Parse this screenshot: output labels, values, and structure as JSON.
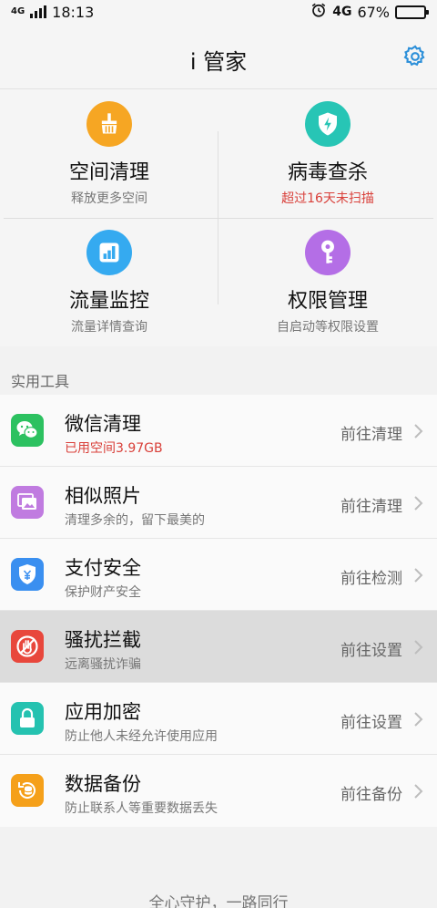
{
  "status_bar": {
    "network_left": "4G",
    "time": "18:13",
    "network_right": "4G",
    "battery_percent_text": "67%",
    "battery_level": 0.67,
    "icons": [
      "signal-icon",
      "alarm-icon",
      "battery-icon"
    ]
  },
  "header": {
    "title": "i 管家",
    "settings_icon": "gear-icon",
    "accent": "#2b8fd9"
  },
  "features": [
    {
      "name": "空间清理",
      "sub": "释放更多空间",
      "icon": "broom-icon",
      "color": "#f6a623"
    },
    {
      "name": "病毒查杀",
      "sub": "超过16天未扫描",
      "icon": "shield-lightning-icon",
      "color": "#27c5b5",
      "sub_color": "#d9403a"
    },
    {
      "name": "流量监控",
      "sub": "流量详情查询",
      "icon": "bar-chart-icon",
      "color": "#35aaf0"
    },
    {
      "name": "权限管理",
      "sub": "自启动等权限设置",
      "icon": "key-icon",
      "color": "#b46ee6"
    }
  ],
  "tools": {
    "section_label": "实用工具",
    "items": [
      {
        "name": "微信清理",
        "sub": "已用空间3.97GB",
        "action": "前往清理",
        "icon": "wechat-icon",
        "color": "#2cc160",
        "sub_color": "#d9403a"
      },
      {
        "name": "相似照片",
        "sub": "清理多余的，留下最美的",
        "action": "前往清理",
        "icon": "photos-icon",
        "color": "#c07be0"
      },
      {
        "name": "支付安全",
        "sub": "保护财产安全",
        "action": "前往检测",
        "icon": "payment-shield-icon",
        "color": "#3a8ff0"
      },
      {
        "name": "骚扰拦截",
        "sub": "远离骚扰诈骗",
        "action": "前往设置",
        "icon": "block-hand-icon",
        "color": "#e8473c",
        "pressed": true
      },
      {
        "name": "应用加密",
        "sub": "防止他人未经允许使用应用",
        "action": "前往设置",
        "icon": "lock-icon",
        "color": "#25c2b0"
      },
      {
        "name": "数据备份",
        "sub": "防止联系人等重要数据丢失",
        "action": "前往备份",
        "icon": "backup-icon",
        "color": "#f5a01a"
      }
    ]
  },
  "footer": {
    "slogan": "全心守护，一路同行"
  }
}
